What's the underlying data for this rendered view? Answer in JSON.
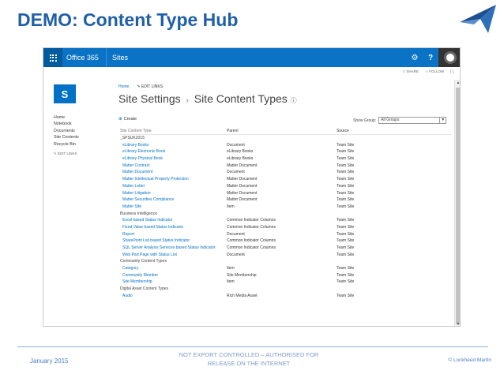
{
  "slide": {
    "title": "DEMO: Content Type Hub",
    "footer_date": "January 2015",
    "footer_notice": "NOT EXPORT CONTROLLED – AUTHORISED FOR RELEASE ON THE INTERNET",
    "footer_copyright": "© Lockheed Martin"
  },
  "suite": {
    "app_name": "Office 365",
    "section": "Sites",
    "gear_icon": "gear-icon",
    "help_label": "?"
  },
  "actions": {
    "share": "SHARE",
    "follow": "FOLLOW",
    "focus": "[ ]"
  },
  "site": {
    "logo_letter": "S",
    "breadcrumb_home": "Home",
    "edit_links": "EDIT LINKS",
    "title_main": "Site Settings",
    "title_sep": "›",
    "title_sub": "Site Content Types",
    "title_info": "ⓘ"
  },
  "leftnav": {
    "items": [
      "Home",
      "Notebook",
      "Documents",
      "Site Contents",
      "Recycle Bin"
    ],
    "edit_links": "EDIT LINKS"
  },
  "toolbar": {
    "create_label": "Create",
    "show_group_label": "Show Group:",
    "show_group_value": "All Groups"
  },
  "table": {
    "headers": [
      "Site Content Type",
      "Parent",
      "Source"
    ],
    "rows": [
      {
        "type": "group",
        "name": "_SPSUK2015"
      },
      {
        "type": "item",
        "name": "eLibrary Books",
        "parent": "Document",
        "source": "Team Site"
      },
      {
        "type": "item",
        "name": "eLibrary Electronic Book",
        "parent": "eLibrary Books",
        "source": "Team Site"
      },
      {
        "type": "item",
        "name": "eLibrary Physical Book",
        "parent": "eLibrary Books",
        "source": "Team Site"
      },
      {
        "type": "item",
        "name": "Matter Contract",
        "parent": "Matter Document",
        "source": "Team Site"
      },
      {
        "type": "item",
        "name": "Matter Document",
        "parent": "Document",
        "source": "Team Site"
      },
      {
        "type": "item",
        "name": "Matter Intellectual Property Protection",
        "parent": "Matter Document",
        "source": "Team Site"
      },
      {
        "type": "item",
        "name": "Matter Letter",
        "parent": "Matter Document",
        "source": "Team Site"
      },
      {
        "type": "item",
        "name": "Matter Litigation",
        "parent": "Matter Document",
        "source": "Team Site"
      },
      {
        "type": "item",
        "name": "Matter Securities Compliance",
        "parent": "Matter Document",
        "source": "Team Site"
      },
      {
        "type": "item",
        "name": "Matter Site",
        "parent": "Item",
        "source": "Team Site"
      },
      {
        "type": "group",
        "name": "Business Intelligence"
      },
      {
        "type": "item",
        "name": "Excel based Status Indicator",
        "parent": "Common Indicator Columns",
        "source": "Team Site"
      },
      {
        "type": "item",
        "name": "Fixed Value based Status Indicator",
        "parent": "Common Indicator Columns",
        "source": "Team Site"
      },
      {
        "type": "item",
        "name": "Report",
        "parent": "Document",
        "source": "Team Site"
      },
      {
        "type": "item",
        "name": "SharePoint List based Status Indicator",
        "parent": "Common Indicator Columns",
        "source": "Team Site"
      },
      {
        "type": "item",
        "name": "SQL Server Analysis Services based Status Indicator",
        "parent": "Common Indicator Columns",
        "source": "Team Site"
      },
      {
        "type": "item",
        "name": "Web Part Page with Status List",
        "parent": "Document",
        "source": "Team Site"
      },
      {
        "type": "group",
        "name": "Community Content Types"
      },
      {
        "type": "item",
        "name": "Category",
        "parent": "Item",
        "source": "Team Site"
      },
      {
        "type": "item",
        "name": "Community Member",
        "parent": "Site Membership",
        "source": "Team Site"
      },
      {
        "type": "item",
        "name": "Site Membership",
        "parent": "Item",
        "source": "Team Site"
      },
      {
        "type": "group",
        "name": "Digital Asset Content Types"
      },
      {
        "type": "item",
        "name": "Audio",
        "parent": "Rich Media Asset",
        "source": "Team Site"
      }
    ]
  },
  "colors": {
    "title_blue": "#1f5fa8",
    "suite_blue": "#0a73c6",
    "link_blue": "#0072c6"
  }
}
